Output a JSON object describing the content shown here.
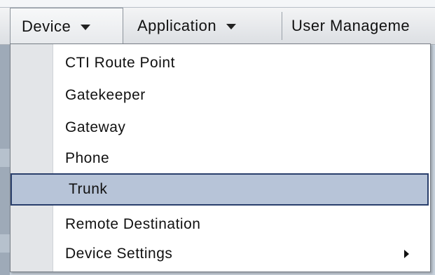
{
  "menubar": {
    "items": [
      {
        "label": "Device",
        "active": true
      },
      {
        "label": "Application"
      },
      {
        "label": "User Manageme"
      }
    ]
  },
  "dropdown": {
    "items": [
      {
        "label": "CTI Route Point"
      },
      {
        "label": "Gatekeeper"
      },
      {
        "label": "Gateway"
      },
      {
        "label": "Phone"
      },
      {
        "label": "Trunk",
        "selected": true
      },
      {
        "label": "Remote Destination"
      },
      {
        "label": "Device Settings",
        "has_submenu": true
      }
    ]
  },
  "colors": {
    "selection_fill": "#b7c4d8",
    "selection_border": "#2a3f6c"
  }
}
